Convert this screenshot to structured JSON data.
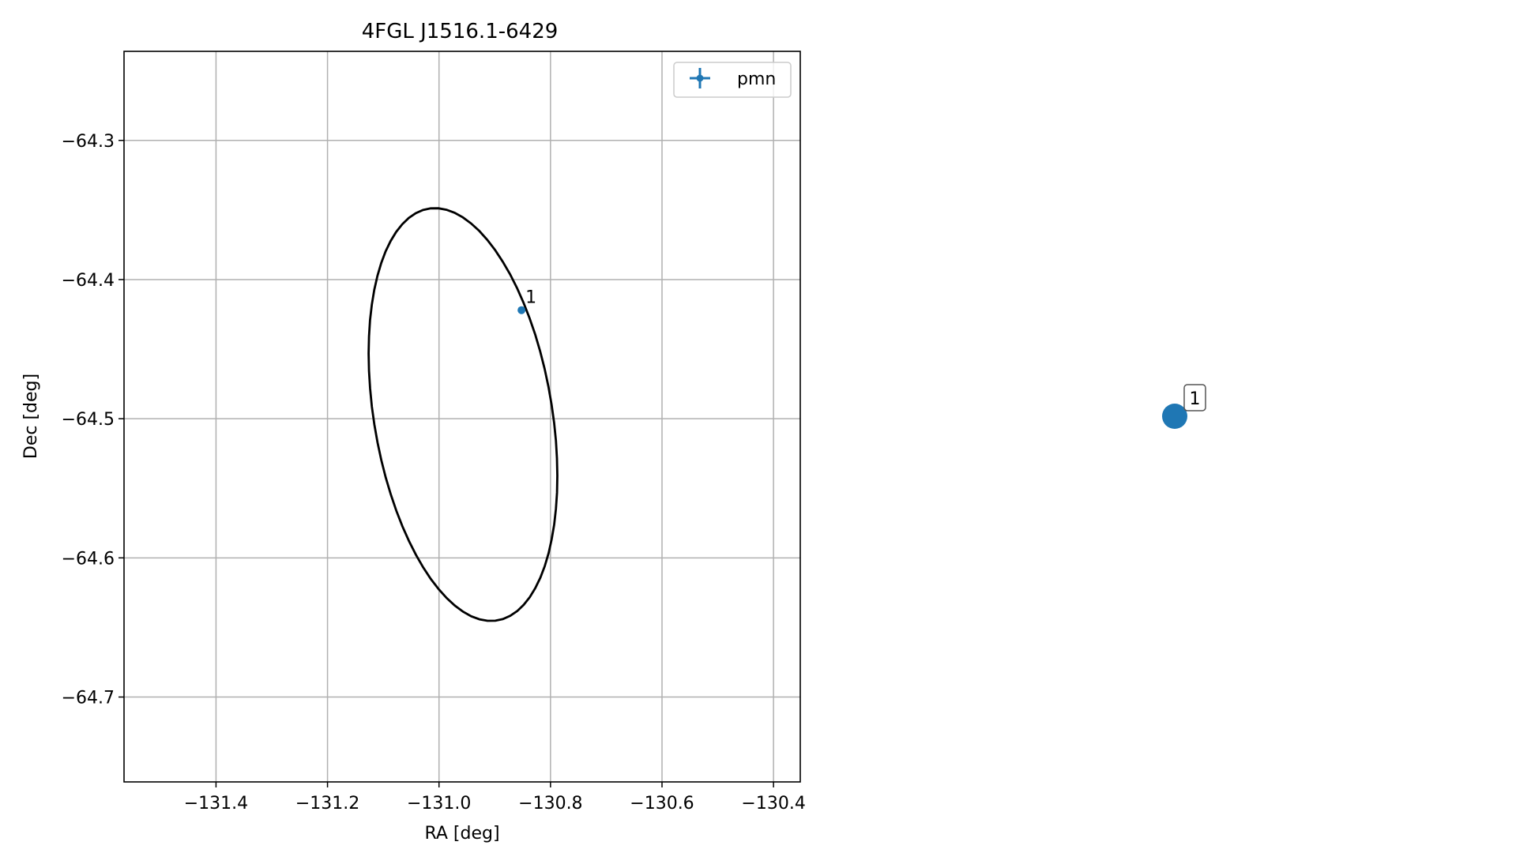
{
  "chart_data": {
    "type": "scatter",
    "title": "4FGL J1516.1-6429",
    "xlabel": "RA [deg]",
    "ylabel": "Dec [deg]",
    "xlim": [
      -131.565,
      -130.352
    ],
    "ylim": [
      -64.761,
      -64.236
    ],
    "grid": true,
    "legend_placement": "upper right",
    "x_ticks": [
      -131.4,
      -131.2,
      -131.0,
      -130.8,
      -130.6,
      -130.4
    ],
    "x_tick_labels": [
      "−131.4",
      "−131.2",
      "−131.0",
      "−130.8",
      "−130.6",
      "−130.4"
    ],
    "y_ticks": [
      -64.3,
      -64.4,
      -64.5,
      -64.6,
      -64.7
    ],
    "y_tick_labels": [
      "−64.3",
      "−64.4",
      "−64.5",
      "−64.6",
      "−64.7"
    ],
    "series": [
      {
        "name": "pmn",
        "color": "#1f77b4",
        "points": [
          {
            "x": -130.852,
            "y": -64.422,
            "label": "1"
          }
        ]
      }
    ],
    "ellipse": {
      "color": "#000000",
      "center": [
        -130.957,
        -64.497
      ],
      "semi_major_deg": 0.183,
      "semi_minor_deg": 0.131,
      "orientation_deg": 33
    },
    "inset": {
      "marker_color": "#1f77b4",
      "label": "1"
    }
  }
}
